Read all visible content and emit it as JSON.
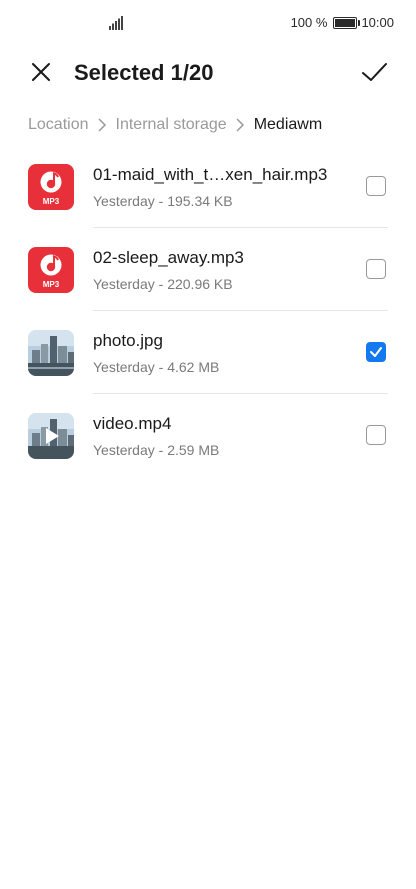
{
  "status_bar": {
    "battery_text": "100 %",
    "time": "10:00"
  },
  "header": {
    "title": "Selected 1/20"
  },
  "breadcrumb": {
    "items": [
      "Location",
      "Internal storage",
      "Mediawm"
    ]
  },
  "files": [
    {
      "name": "01-maid_with_t…xen_hair.mp3",
      "meta": "Yesterday - 195.34 KB",
      "type_label": "MP3",
      "checked": false
    },
    {
      "name": "02-sleep_away.mp3",
      "meta": "Yesterday - 220.96 KB",
      "type_label": "MP3",
      "checked": false
    },
    {
      "name": "photo.jpg",
      "meta": "Yesterday - 4.62 MB",
      "checked": true
    },
    {
      "name": "video.mp4",
      "meta": "Yesterday - 2.59 MB",
      "checked": false
    }
  ],
  "colors": {
    "accent": "#1478f0",
    "music_icon": "#e8303a"
  }
}
